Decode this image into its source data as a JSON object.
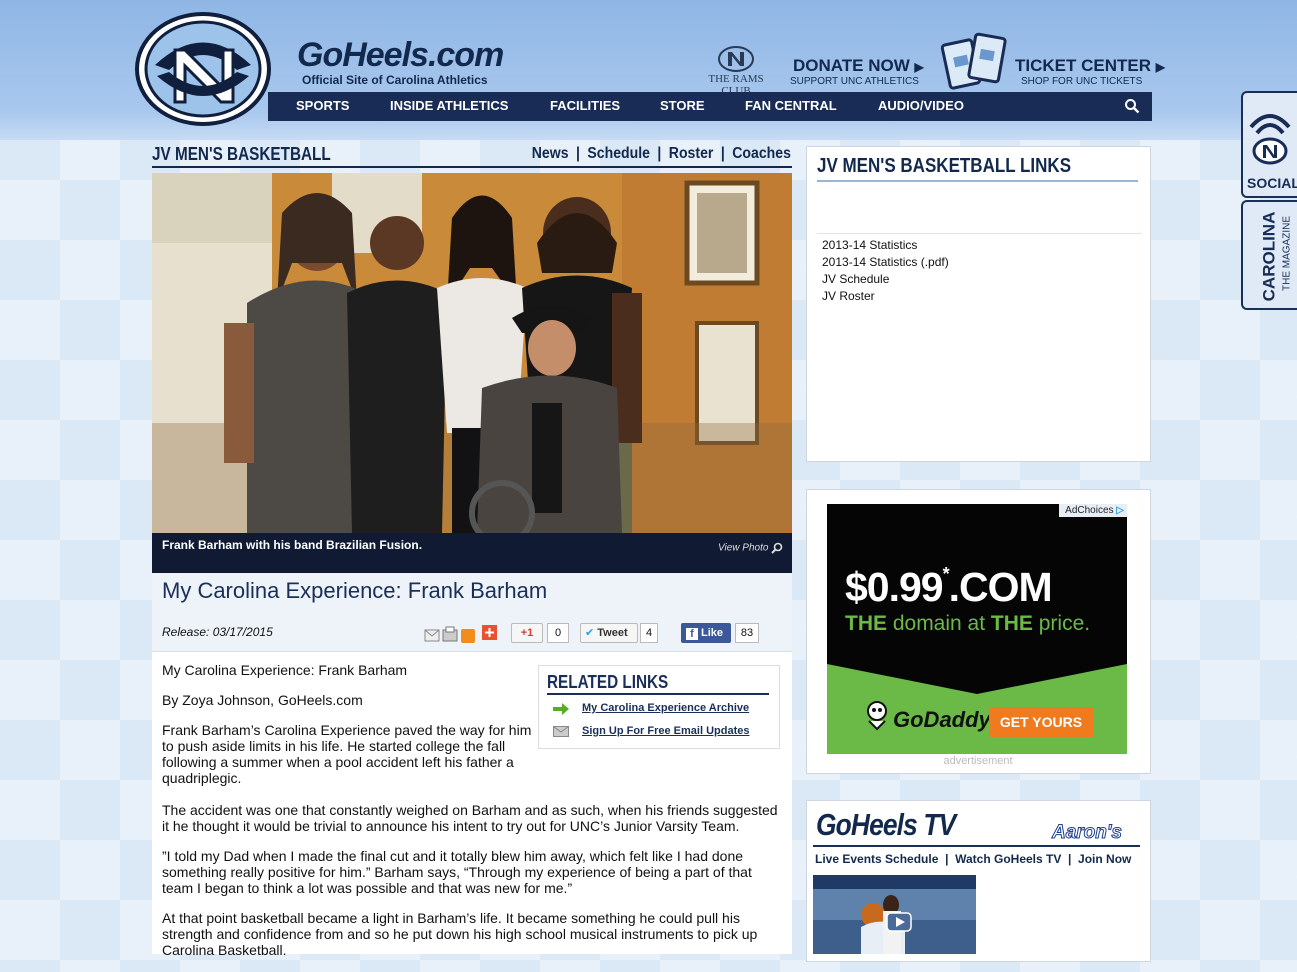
{
  "header": {
    "site_title": "GoHeels.com",
    "site_subtitle": "Official Site of Carolina Athletics",
    "rams_club": "THE RAMS CLUB",
    "donate_label": "DONATE NOW",
    "donate_sub": "SUPPORT UNC ATHLETICS",
    "ticket_label": "TICKET CENTER",
    "ticket_sub": "SHOP FOR UNC TICKETS"
  },
  "nav": {
    "items": [
      "SPORTS",
      "INSIDE ATHLETICS",
      "FACILITIES",
      "STORE",
      "FAN CENTRAL",
      "AUDIO/VIDEO"
    ]
  },
  "side_tabs": {
    "social": "SOCIAL",
    "magazine_title": "CAROLINA",
    "magazine_sub": "THE MAGAZINE"
  },
  "section": {
    "title": "JV MEN'S BASKETBALL",
    "links": [
      "News",
      "Schedule",
      "Roster",
      "Coaches"
    ],
    "separator": "|"
  },
  "photo": {
    "caption": "Frank Barham with his band Brazilian Fusion.",
    "view_label": "View Photo"
  },
  "article": {
    "title": "My Carolina Experience: Frank Barham",
    "release": "Release: 03/17/2015",
    "gplus_label": "+1",
    "gplus_count": "0",
    "tweet_label": "Tweet",
    "tweet_count": "4",
    "like_label": "Like",
    "like_count": "83",
    "paragraphs": [
      "My Carolina Experience: Frank Barham",
      "By Zoya Johnson, GoHeels.com",
      "Frank Barham’s Carolina Experience paved the way for him to push aside limits in his life. He started college the fall following a summer when a pool accident left his father a quadriplegic.",
      "The accident was one that constantly weighed on Barham and as such, when his friends suggested it he thought it would be trivial to announce his intent to try out for UNC’s Junior Varsity Team.",
      "”I told my Dad when I made the final cut and it totally blew him away, which felt like I had done something really positive for him.” Barham says, “Through my experience of being a part of that team I began to think a lot was possible and that was new for me.”",
      "At that point basketball became a light in Barham’s life. It became something he could pull his strength and confidence from and so he put down his high school musical instruments to pick up Carolina Basketball."
    ]
  },
  "related": {
    "title": "RELATED LINKS",
    "links": [
      "My Carolina Experience Archive",
      "Sign Up For Free Email Updates"
    ]
  },
  "sidebar": {
    "links_title": "JV MEN'S BASKETBALL LINKS",
    "links": [
      "2013-14 Statistics",
      "2013-14 Statistics (.pdf)",
      "JV Schedule",
      "JV Roster"
    ]
  },
  "ad": {
    "adchoices": "AdChoices",
    "price": "$0.99",
    "star": "*",
    "com": ".COM",
    "tag_the1": "THE",
    "tag_mid": " domain at ",
    "tag_the2": "THE",
    "tag_end": " price.",
    "brand": "GoDaddy",
    "cta": "GET YOURS",
    "label": "advertisement"
  },
  "tv": {
    "logo": "GoHeels TV",
    "sponsor": "Aaron's",
    "links": [
      "Live Events Schedule",
      "Watch GoHeels TV",
      "Join Now"
    ],
    "separator": "|"
  },
  "colors": {
    "navy": "#182c56",
    "carolina_blue": "#8fb6e5",
    "godaddy_green": "#6bb946",
    "godaddy_orange": "#f07b1f"
  }
}
